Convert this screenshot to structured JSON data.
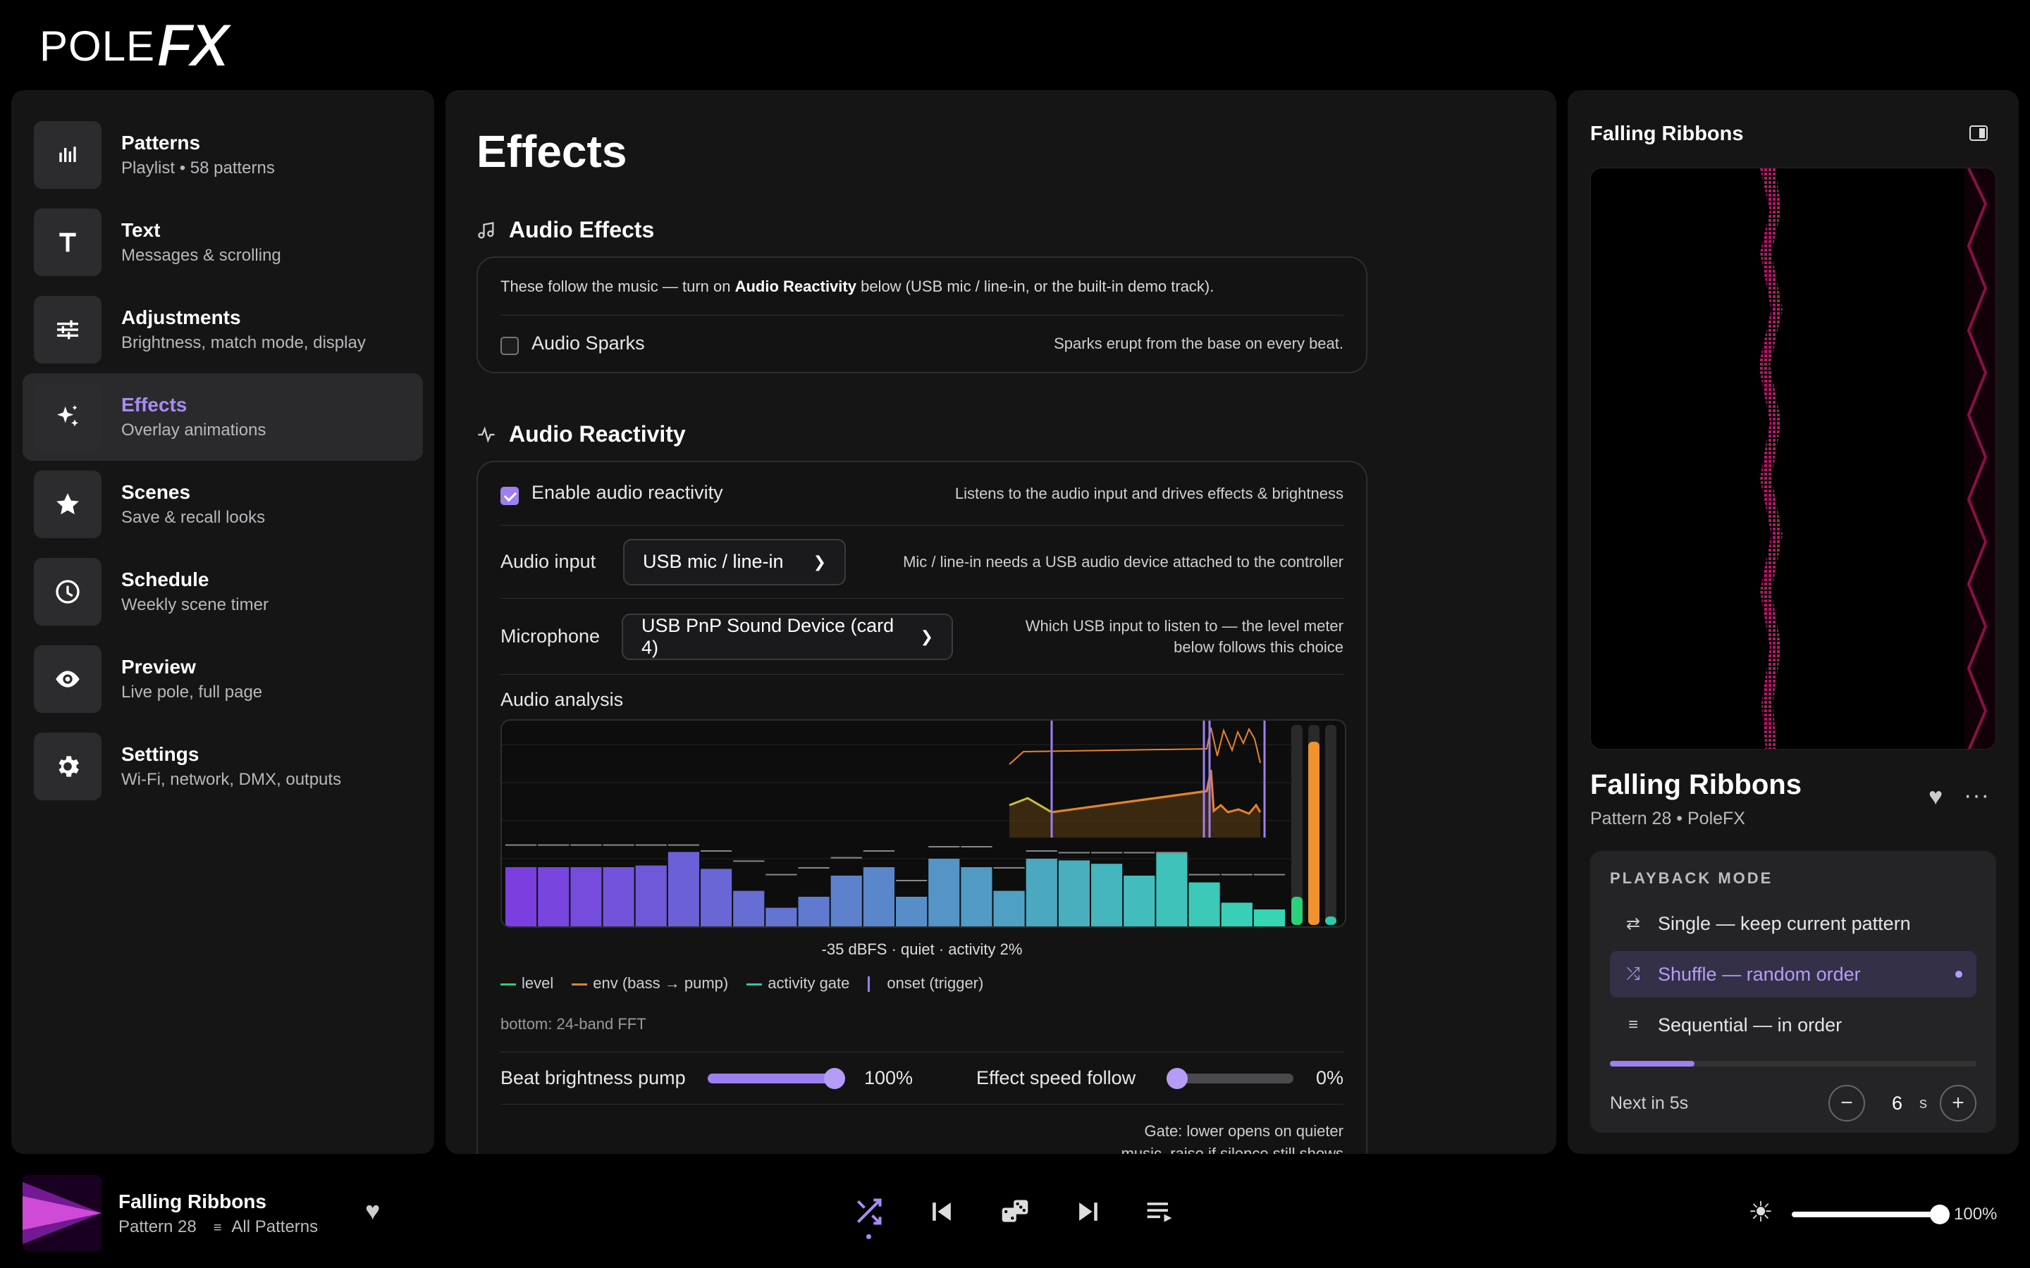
{
  "logo": {
    "pole": "POLE",
    "fx": "FX"
  },
  "sidebar": {
    "items": [
      {
        "title": "Patterns",
        "sub": "Playlist • 58 patterns",
        "icon": "bars-icon"
      },
      {
        "title": "Text",
        "sub": "Messages & scrolling",
        "icon": "text-icon"
      },
      {
        "title": "Adjustments",
        "sub": "Brightness, match mode, display",
        "icon": "sliders-icon"
      },
      {
        "title": "Effects",
        "sub": "Overlay animations",
        "icon": "sparkle-icon",
        "active": true
      },
      {
        "title": "Scenes",
        "sub": "Save & recall looks",
        "icon": "star-icon"
      },
      {
        "title": "Schedule",
        "sub": "Weekly scene timer",
        "icon": "clock-icon"
      },
      {
        "title": "Preview",
        "sub": "Live pole, full page",
        "icon": "eye-icon"
      },
      {
        "title": "Settings",
        "sub": "Wi-Fi, network, DMX, outputs",
        "icon": "gear-icon"
      }
    ]
  },
  "main": {
    "title": "Effects",
    "audio_effects": {
      "heading": "Audio Effects",
      "note_pre": "These follow the music — turn on ",
      "note_bold": "Audio Reactivity",
      "note_post": " below (USB mic / line-in, or the built-in demo track).",
      "sparks_label": "Audio Sparks",
      "sparks_desc": "Sparks erupt from the base on every beat."
    },
    "audio_reactivity": {
      "heading": "Audio Reactivity",
      "enable_label": "Enable audio reactivity",
      "enable_desc": "Listens to the audio input and drives effects & brightness",
      "input_label": "Audio input",
      "input_value": "USB mic / line-in",
      "input_desc": "Mic / line-in needs a USB audio device attached to the controller",
      "mic_label": "Microphone",
      "mic_value": "USB PnP Sound Device (card 4)",
      "mic_desc_1": "Which USB input to listen to — the level meter",
      "mic_desc_2": "below follows this choice",
      "analysis_label": "Audio analysis",
      "readout": "-35 dBFS · quiet · activity 2%",
      "legend": [
        "level",
        "env (bass → pump)",
        "activity gate",
        "onset (trigger)"
      ],
      "fft_note": "bottom: 24-band FFT",
      "pump_label": "Beat brightness pump",
      "pump_value": "100%",
      "speed_label": "Effect speed follow",
      "speed_value": "0%",
      "gate_desc_1": "Gate: lower opens on quieter",
      "gate_desc_2": "music, raise if silence still shows"
    }
  },
  "chart_data": {
    "type": "bar",
    "title": "",
    "xlabel": "",
    "ylabel": "",
    "categories": [
      "1",
      "2",
      "3",
      "4",
      "5",
      "6",
      "7",
      "8",
      "9",
      "10",
      "11",
      "12",
      "13",
      "14",
      "15",
      "16",
      "17",
      "18",
      "19",
      "20",
      "21",
      "22",
      "23",
      "24"
    ],
    "values": [
      0.7,
      0.7,
      0.7,
      0.7,
      0.72,
      0.88,
      0.68,
      0.42,
      0.22,
      0.35,
      0.6,
      0.7,
      0.35,
      0.8,
      0.7,
      0.42,
      0.8,
      0.78,
      0.74,
      0.6,
      0.88,
      0.52,
      0.28,
      0.2
    ],
    "peaks": [
      0.97,
      0.97,
      0.97,
      0.97,
      0.97,
      0.97,
      0.9,
      0.78,
      0.62,
      0.7,
      0.82,
      0.9,
      0.55,
      0.95,
      0.95,
      0.7,
      0.9,
      0.88,
      0.88,
      0.88,
      0.88,
      0.62,
      0.62,
      0.62
    ],
    "ylim": [
      0,
      1
    ],
    "colors": {
      "start": "#7b3fe0",
      "end": "#36d6b4"
    }
  },
  "right": {
    "title": "Falling Ribbons",
    "track_name": "Falling Ribbons",
    "track_sub": "Pattern 28 • PoleFX",
    "playback_heading": "PLAYBACK MODE",
    "modes": [
      {
        "label": "Single — keep current pattern",
        "icon": "repeat-icon"
      },
      {
        "label": "Shuffle — random order",
        "icon": "shuffle-icon",
        "selected": true
      },
      {
        "label": "Sequential — in order",
        "icon": "list-icon"
      }
    ],
    "next_label": "Next in 5s",
    "interval_value": "6",
    "interval_unit": "s",
    "progress": 0.23
  },
  "bottom": {
    "title": "Falling Ribbons",
    "sub_pattern": "Pattern 28",
    "sub_list": "All Patterns",
    "brightness": "100%",
    "brightness_level": 1.0
  },
  "colors": {
    "accent": "#9d7ff0",
    "panel": "#151515",
    "pink": "#c0186a"
  }
}
